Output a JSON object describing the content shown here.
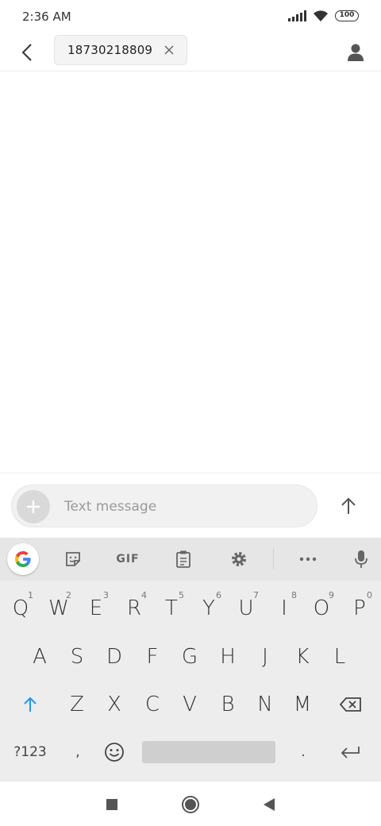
{
  "status_bar": {
    "time": "2:36 AM",
    "battery": "100"
  },
  "header": {
    "recipient": "18730218809"
  },
  "compose": {
    "placeholder": "Text message"
  },
  "keyboard": {
    "toolbar": {
      "gif": "GIF"
    },
    "row1": [
      {
        "letter": "Q",
        "num": "1"
      },
      {
        "letter": "W",
        "num": "2"
      },
      {
        "letter": "E",
        "num": "3"
      },
      {
        "letter": "R",
        "num": "4"
      },
      {
        "letter": "T",
        "num": "5"
      },
      {
        "letter": "Y",
        "num": "6"
      },
      {
        "letter": "U",
        "num": "7"
      },
      {
        "letter": "I",
        "num": "8"
      },
      {
        "letter": "O",
        "num": "9"
      },
      {
        "letter": "P",
        "num": "0"
      }
    ],
    "row2": [
      "A",
      "S",
      "D",
      "F",
      "G",
      "H",
      "J",
      "K",
      "L"
    ],
    "row3": [
      "Z",
      "X",
      "C",
      "V",
      "B",
      "N",
      "M"
    ],
    "row4": {
      "symbols": "?123",
      "comma": ",",
      "period": "."
    }
  },
  "colors": {
    "accent": "#2196f3",
    "icon": "#666666",
    "keyboard_bg": "#ededed"
  }
}
